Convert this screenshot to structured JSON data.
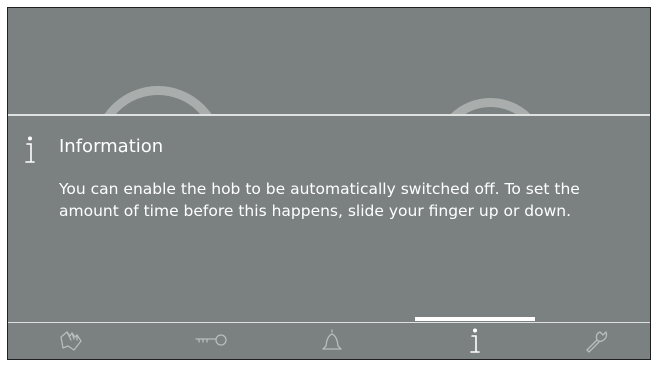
{
  "info": {
    "icon": "info-icon",
    "title": "Information",
    "body": "You can enable the hob to be automatically switched off. To set the amount of time before this happens, slide your finger up or down."
  },
  "bottom_nav": {
    "items": [
      {
        "icon": "wipe-protection-hand-icon"
      },
      {
        "icon": "key-lock-icon"
      },
      {
        "icon": "bell-timer-icon"
      },
      {
        "icon": "info-icon",
        "active": true
      },
      {
        "icon": "wrench-settings-icon"
      }
    ]
  },
  "colors": {
    "background": "#7a8180",
    "text": "#ffffff",
    "divider": "#dfe2e1",
    "active_indicator": "#ffffff"
  }
}
